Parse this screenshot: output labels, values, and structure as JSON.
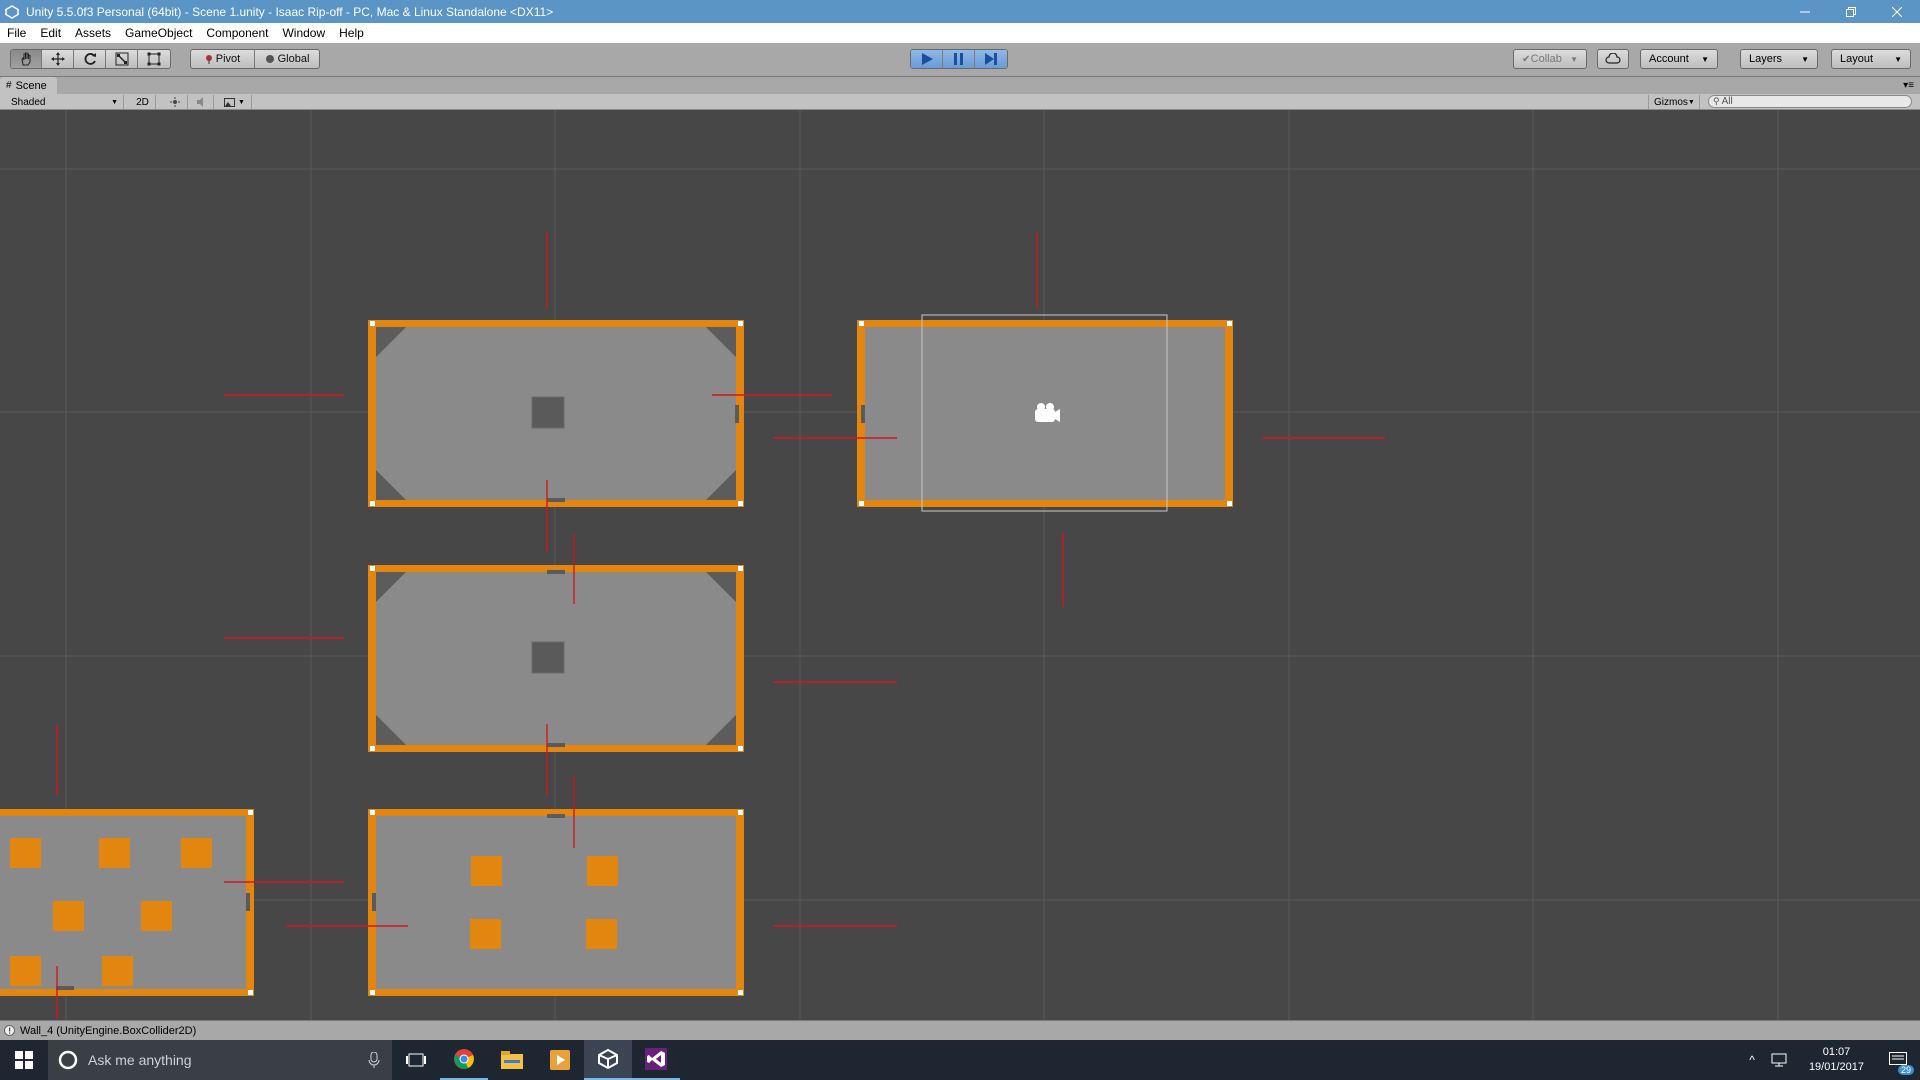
{
  "window": {
    "title": "Unity 5.5.0f3 Personal (64bit) - Scene 1.unity - Isaac Rip-off - PC, Mac & Linux Standalone <DX11>",
    "minimize_icon": "minimize-icon",
    "restore_icon": "restore-icon",
    "close_icon": "close-icon"
  },
  "menu": [
    "File",
    "Edit",
    "Assets",
    "GameObject",
    "Component",
    "Window",
    "Help"
  ],
  "toolbar": {
    "transform_tools": [
      "hand-tool-icon",
      "move-tool-icon",
      "rotate-tool-icon",
      "scale-tool-icon",
      "rect-tool-icon"
    ],
    "pivot_label": "Pivot",
    "global_label": "Global",
    "play_icons": [
      "play-icon",
      "pause-icon",
      "step-icon"
    ],
    "collab_label": "Collab",
    "account_label": "Account",
    "layers_label": "Layers",
    "layout_label": "Layout"
  },
  "scene_tab": {
    "label": "Scene"
  },
  "scene_toolbar": {
    "shading_mode": "Shaded",
    "mode_2d_label": "2D",
    "gizmos_label": "Gizmos",
    "search_placeholder": "All"
  },
  "status": {
    "message": "Wall_4 (UnityEngine.BoxCollider2D)"
  },
  "taskbar": {
    "search_placeholder": "Ask me anything",
    "time": "01:07",
    "date": "19/01/2017",
    "notification_count": "29"
  },
  "colors": {
    "title_bar": "#5a95c5",
    "wall_orange": "#e2860f",
    "room_floor": "#8a8a8a",
    "scene_background": "#474747",
    "play_active": "#6a9bd6"
  }
}
